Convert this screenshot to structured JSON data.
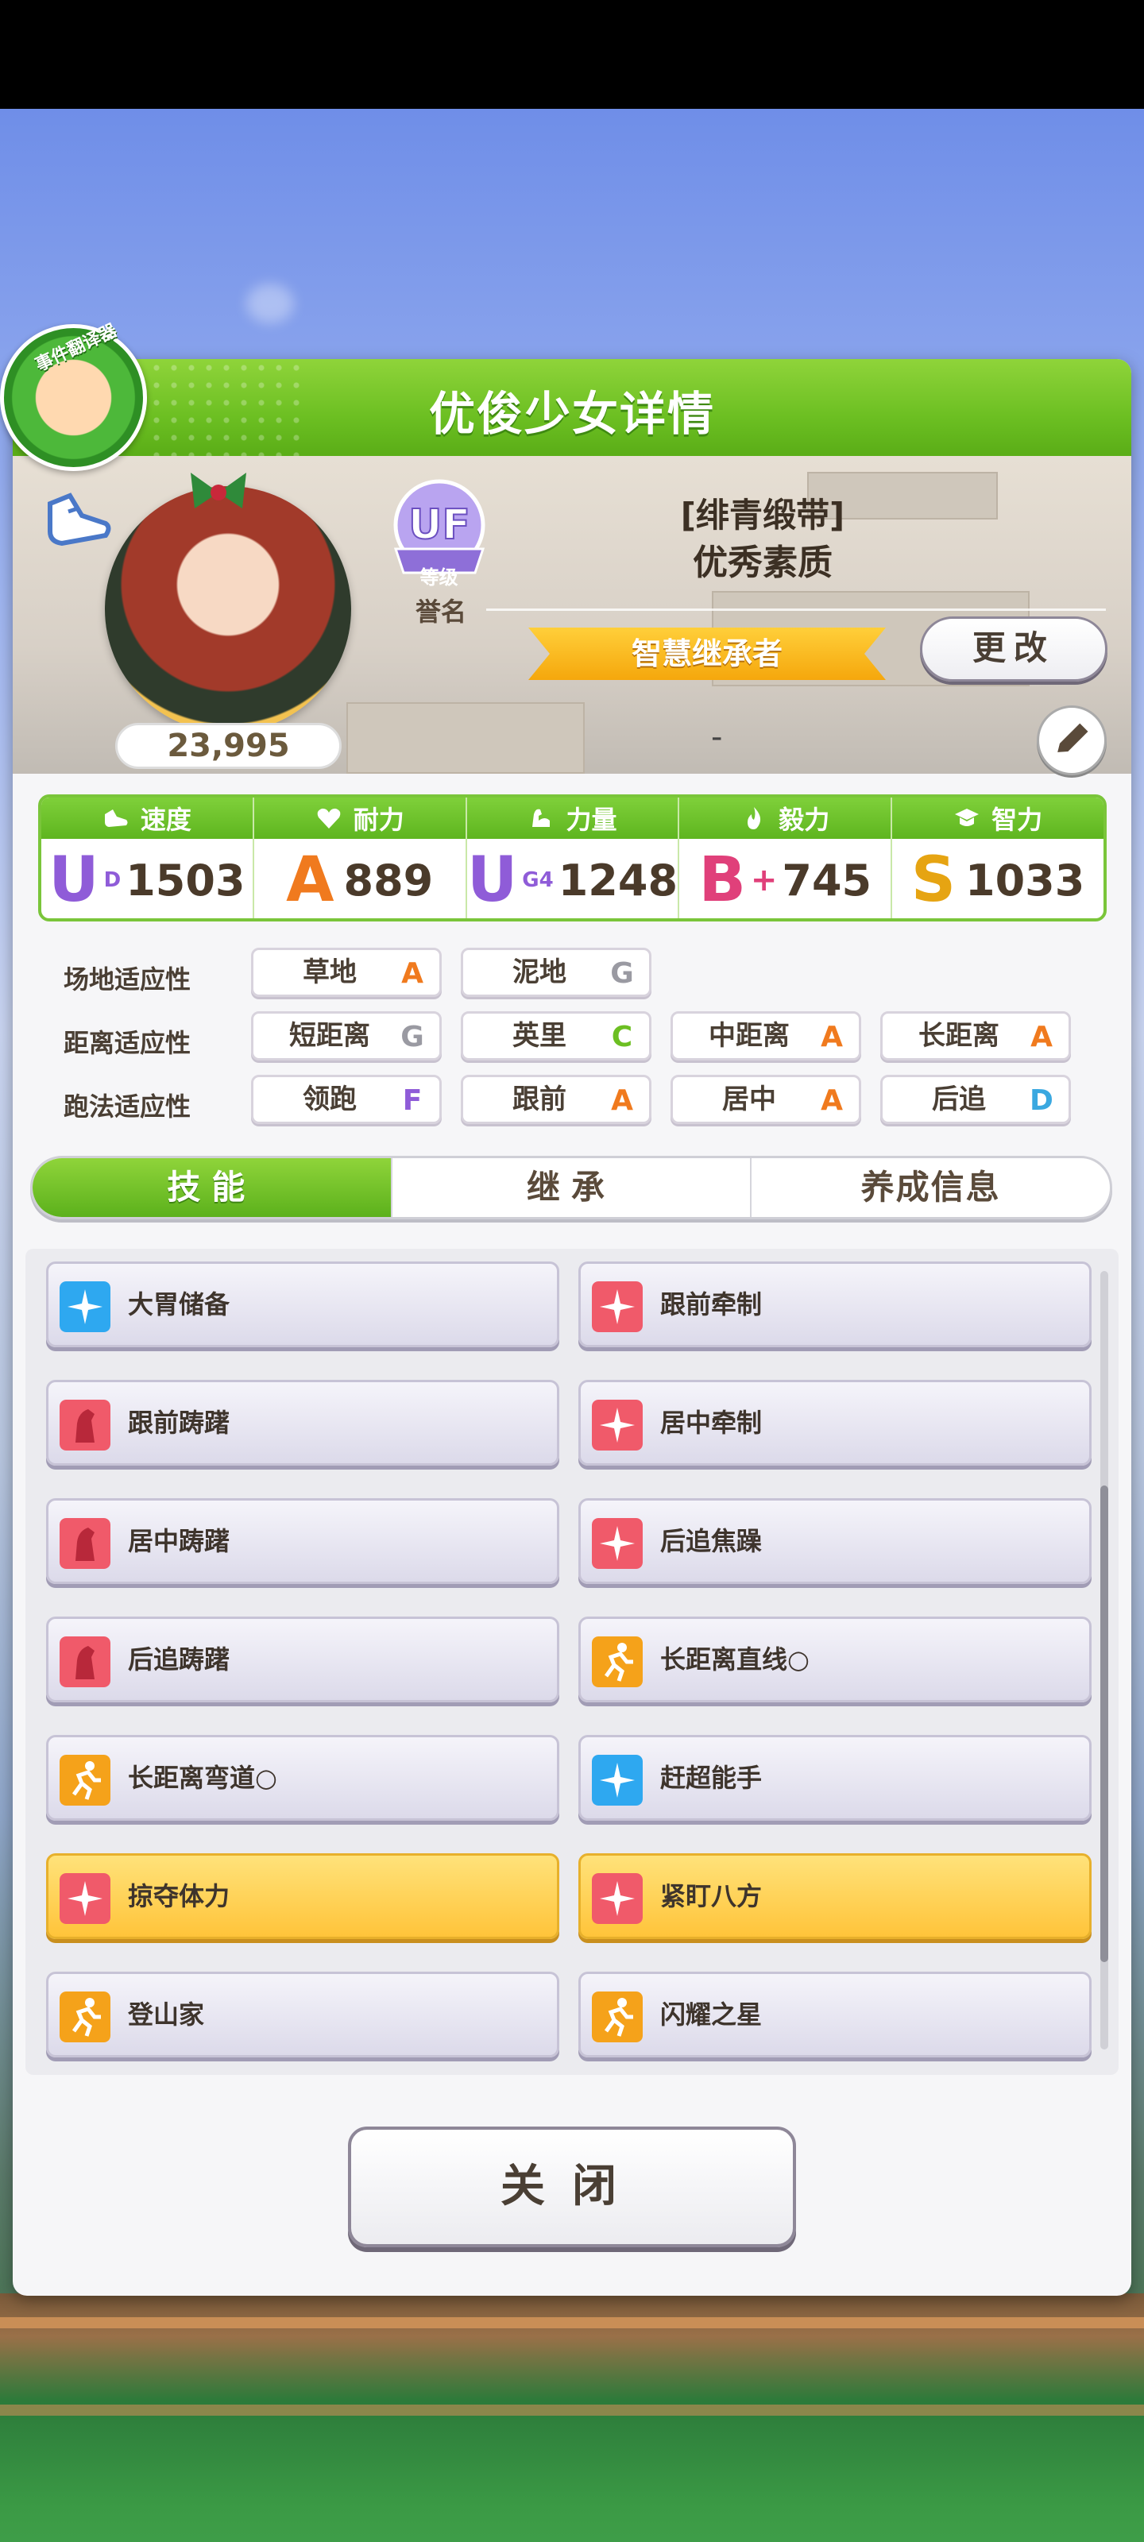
{
  "header": {
    "title": "优俊少女详情"
  },
  "event_badge": {
    "label": "事件翻译器"
  },
  "profile": {
    "fans": "23,995",
    "rank": {
      "grade": "UF",
      "caption": "等级"
    },
    "honor_label": "誉名",
    "title_line1": "[绯青缎带]",
    "title_line2": "优秀素质",
    "inherit_banner": "智慧继承者",
    "change_button": "更改",
    "dash": "-"
  },
  "stats": [
    {
      "name": "速度",
      "icon": "shoe-icon",
      "grade": "U",
      "grade_sub": "D",
      "value": "1503",
      "color": "#8f5cd8"
    },
    {
      "name": "耐力",
      "icon": "heart-icon",
      "grade": "A",
      "grade_sub": "",
      "value": "889",
      "color": "#f07a1e"
    },
    {
      "name": "力量",
      "icon": "muscle-icon",
      "grade": "U",
      "grade_sub": "G4",
      "value": "1248",
      "color": "#8f5cd8"
    },
    {
      "name": "毅力",
      "icon": "flame-icon",
      "grade": "B",
      "grade_sub": "+",
      "value": "745",
      "color": "#e0407a"
    },
    {
      "name": "智力",
      "icon": "graduation-cap-icon",
      "grade": "S",
      "grade_sub": "",
      "value": "1033",
      "color": "#e6a412"
    }
  ],
  "aptitude": {
    "rows": [
      {
        "label": "场地适应性",
        "items": [
          {
            "name": "草地",
            "grade": "A"
          },
          {
            "name": "泥地",
            "grade": "G"
          }
        ]
      },
      {
        "label": "距离适应性",
        "items": [
          {
            "name": "短距离",
            "grade": "G"
          },
          {
            "name": "英里",
            "grade": "C"
          },
          {
            "name": "中距离",
            "grade": "A"
          },
          {
            "name": "长距离",
            "grade": "A"
          }
        ]
      },
      {
        "label": "跑法适应性",
        "items": [
          {
            "name": "领跑",
            "grade": "F"
          },
          {
            "name": "跟前",
            "grade": "A"
          },
          {
            "name": "居中",
            "grade": "A"
          },
          {
            "name": "后追",
            "grade": "D"
          }
        ]
      }
    ],
    "grade_colors": {
      "A": "#f07a1e",
      "G": "#9a9aa2",
      "C": "#6cbf22",
      "F": "#8f5cd8",
      "D": "#3aa8e0"
    }
  },
  "tabs": [
    {
      "label": "技能",
      "active": true
    },
    {
      "label": "继承",
      "active": false
    },
    {
      "label": "养成信息",
      "active": false
    }
  ],
  "skills": [
    {
      "label": "大胃储备",
      "icon": "sparkle-blue-icon",
      "style": "normal"
    },
    {
      "label": "跟前牵制",
      "icon": "sparkle-red-icon",
      "style": "normal"
    },
    {
      "label": "跟前踌躇",
      "icon": "horse-red-icon",
      "style": "normal"
    },
    {
      "label": "居中牵制",
      "icon": "sparkle-red-icon",
      "style": "normal"
    },
    {
      "label": "居中踌躇",
      "icon": "horse-red-icon",
      "style": "normal"
    },
    {
      "label": "后追焦躁",
      "icon": "sparkle-red-icon",
      "style": "normal"
    },
    {
      "label": "后追踌躇",
      "icon": "horse-red-icon",
      "style": "normal"
    },
    {
      "label": "长距离直线○",
      "icon": "runner-orange-icon",
      "style": "normal"
    },
    {
      "label": "长距离弯道○",
      "icon": "runner-orange-icon",
      "style": "normal"
    },
    {
      "label": "赶超能手",
      "icon": "sparkle-blue-icon",
      "style": "normal"
    },
    {
      "label": "掠夺体力",
      "icon": "sparkle-red-icon",
      "style": "gold"
    },
    {
      "label": "紧盯八方",
      "icon": "sparkle-red-icon",
      "style": "gold"
    },
    {
      "label": "登山家",
      "icon": "runner-orange-icon",
      "style": "normal"
    },
    {
      "label": "闪耀之星",
      "icon": "runner-orange-icon",
      "style": "normal"
    }
  ],
  "close_button": "关闭"
}
